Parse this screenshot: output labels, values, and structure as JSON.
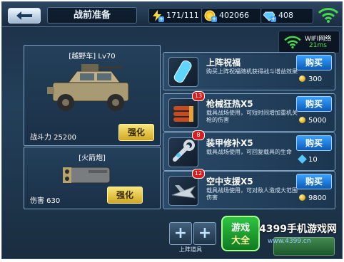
{
  "header": {
    "title": "战前准备",
    "energy": "171/111",
    "coins": "402066",
    "gems": "408"
  },
  "network": {
    "label": "WIFI网络",
    "ping": "21ms"
  },
  "vehicle": {
    "title": "[越野车] Lv70",
    "stat": "战斗力 25200",
    "upgrade": "强化"
  },
  "weapon": {
    "title": "[火箭炮]",
    "stat": "伤害 630",
    "upgrade": "强化"
  },
  "items": [
    {
      "name": "上阵祝福",
      "desc": "购买上阵祝福随机获得战斗增益效果",
      "buy": "购买",
      "price": "300",
      "currency": "coin",
      "icon": "capsule-icon"
    },
    {
      "name": "枪械狂热X5",
      "badge": "13",
      "desc": "载具战场使用，可短时间增加重机关枪的伤害",
      "buy": "购买",
      "price": "5000",
      "currency": "coin",
      "icon": "bullets-icon"
    },
    {
      "name": "装甲修补X5",
      "badge": "8",
      "desc": "载具战场使用，可回复载具的生命",
      "buy": "购买",
      "price": "10",
      "currency": "gem",
      "icon": "wrench-icon"
    },
    {
      "name": "空中支援X5",
      "badge": "12",
      "desc": "载具战场使用，可对敌人造成大范围伤害",
      "buy": "购买",
      "price": "9800",
      "currency": "coin",
      "icon": "jet-icon"
    }
  ],
  "slots": {
    "label": "上阵道具",
    "plus": "+"
  },
  "watermark": {
    "badge_line1": "游戏",
    "badge_line2": "大全",
    "site": "4399手机游戏网",
    "url": "www.4399.cn"
  }
}
